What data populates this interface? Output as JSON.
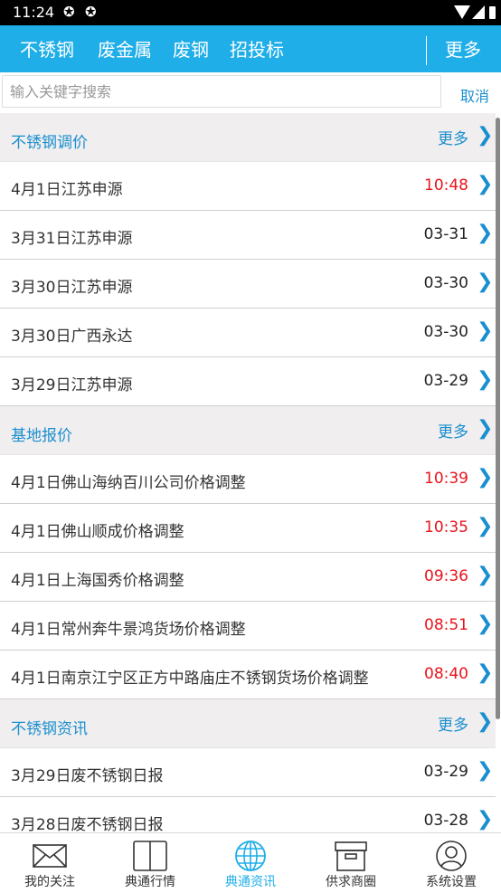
{
  "status_bar": {
    "time": "11:24"
  },
  "top_nav": {
    "tabs": [
      "不锈钢",
      "废金属",
      "废钢",
      "招投标"
    ],
    "more": "更多",
    "accent_color": "#1faee8"
  },
  "search": {
    "placeholder": "输入关键字搜索",
    "value": "",
    "cancel": "取消"
  },
  "sections": [
    {
      "title": "不锈钢调价",
      "more": "更多",
      "items": [
        {
          "title": "4月1日江苏申源",
          "time": "10:48",
          "time_color": "#e8141c"
        },
        {
          "title": "3月31日江苏申源",
          "time": "03-31",
          "time_color": "#222222"
        },
        {
          "title": "3月30日江苏申源",
          "time": "03-30",
          "time_color": "#222222"
        },
        {
          "title": "3月30日广西永达",
          "time": "03-30",
          "time_color": "#222222"
        },
        {
          "title": "3月29日江苏申源",
          "time": "03-29",
          "time_color": "#222222"
        }
      ]
    },
    {
      "title": "基地报价",
      "more": "更多",
      "items": [
        {
          "title": "4月1日佛山海纳百川公司价格调整",
          "time": "10:39",
          "time_color": "#e8141c"
        },
        {
          "title": "4月1日佛山顺成价格调整",
          "time": "10:35",
          "time_color": "#e8141c"
        },
        {
          "title": "4月1日上海国秀价格调整",
          "time": "09:36",
          "time_color": "#e8141c"
        },
        {
          "title": "4月1日常州奔牛景鸿货场价格调整",
          "time": "08:51",
          "time_color": "#e8141c"
        },
        {
          "title": "4月1日南京江宁区正方中路庙庄不锈钢货场价格调整",
          "time": "08:40",
          "time_color": "#e8141c"
        }
      ]
    },
    {
      "title": "不锈钢资讯",
      "more": "更多",
      "items": [
        {
          "title": "3月29日废不锈钢日报",
          "time": "03-29",
          "time_color": "#222222"
        },
        {
          "title": "3月28日废不锈钢日报",
          "time": "03-28",
          "time_color": "#222222"
        }
      ]
    }
  ],
  "bottom_nav": [
    {
      "label": "我的关注",
      "icon": "envelope-icon",
      "active": false
    },
    {
      "label": "典通行情",
      "icon": "book-icon",
      "active": false
    },
    {
      "label": "典通资讯",
      "icon": "globe-icon",
      "active": true
    },
    {
      "label": "供求商圈",
      "icon": "archive-box-icon",
      "active": false
    },
    {
      "label": "系统设置",
      "icon": "user-icon",
      "active": false
    }
  ]
}
